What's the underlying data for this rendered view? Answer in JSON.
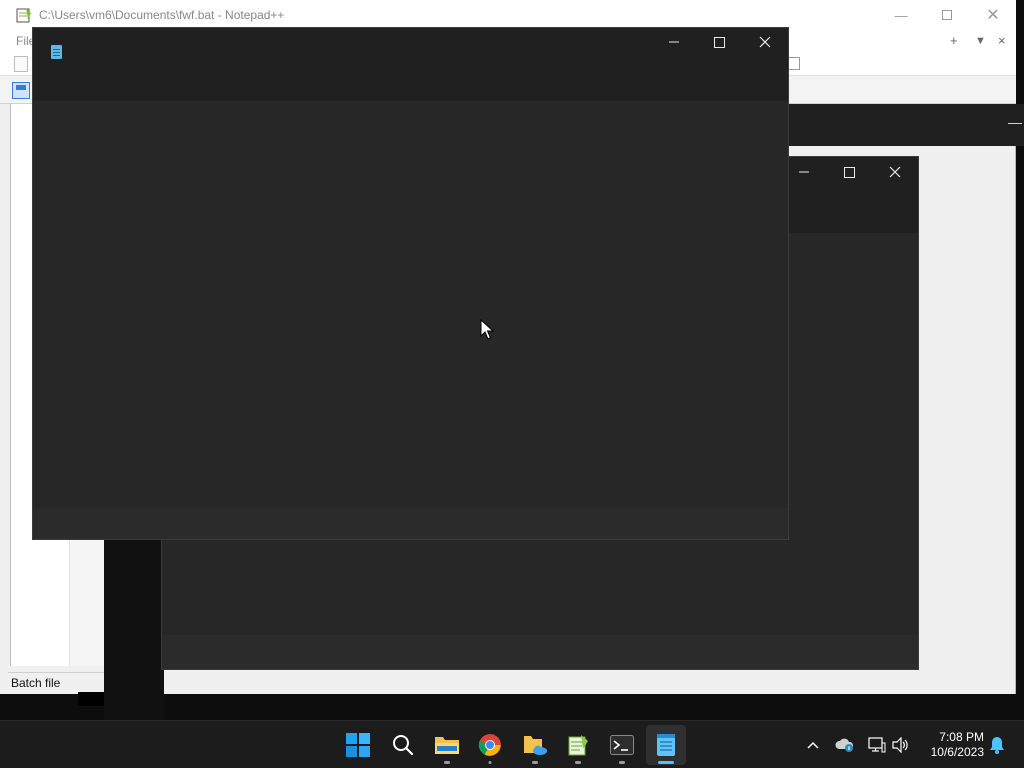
{
  "notepadpp": {
    "title": "C:\\Users\\vm6\\Documents\\fwf.bat - Notepad++",
    "menu_file": "File",
    "status_filetype": "Batch file",
    "menu_right_plus": "+",
    "menu_right_down": "▼",
    "menu_right_close": "×"
  },
  "taskbar": {
    "apps": [
      {
        "name": "start",
        "icon": "windows-logo-icon"
      },
      {
        "name": "search",
        "icon": "search-icon"
      },
      {
        "name": "file-explorer",
        "icon": "folder-icon"
      },
      {
        "name": "chrome",
        "icon": "chrome-icon"
      },
      {
        "name": "documents-folder",
        "icon": "folder-cloud-icon"
      },
      {
        "name": "notepadpp",
        "icon": "notepadpp-icon"
      },
      {
        "name": "terminal",
        "icon": "terminal-icon"
      },
      {
        "name": "notepad",
        "icon": "notepad-icon",
        "active": true
      }
    ],
    "clock_time": "7:08 PM",
    "clock_date": "10/6/2023"
  },
  "colors": {
    "dark_window": "#272727",
    "dark_titlebar": "#202020",
    "taskbar": "#1c1c1c",
    "accent": "#4cc2ff"
  }
}
